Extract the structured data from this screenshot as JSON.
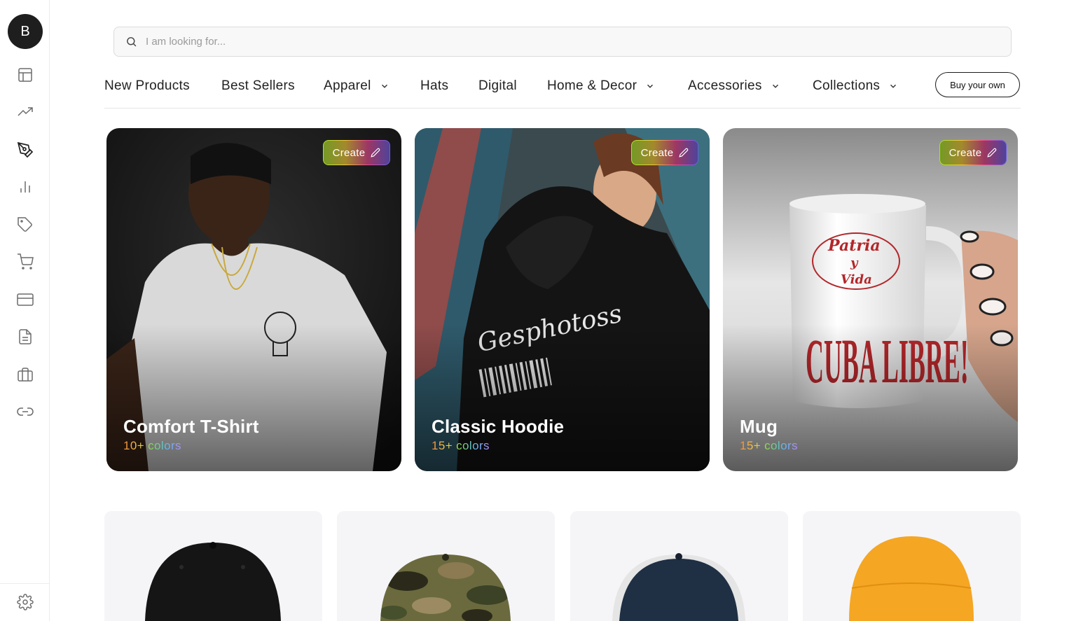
{
  "sidebar": {
    "avatar_initial": "B",
    "icons": [
      "layout-icon",
      "trending-up-icon",
      "pen-tool-icon",
      "bar-chart-icon",
      "tag-icon",
      "cart-icon",
      "credit-card-icon",
      "document-icon",
      "briefcase-icon",
      "link-icon",
      "settings-icon"
    ]
  },
  "search": {
    "placeholder": "I am looking for..."
  },
  "nav": {
    "items": [
      {
        "label": "New Products"
      },
      {
        "label": "Best Sellers"
      },
      {
        "label": "Apparel"
      },
      {
        "label": "Hats"
      },
      {
        "label": "Digital"
      },
      {
        "label": "Home & Decor"
      },
      {
        "label": "Accessories"
      },
      {
        "label": "Collections"
      }
    ],
    "buy_label": "Buy your own"
  },
  "featured": [
    {
      "title": "Comfort T-Shirt",
      "subtitle": "10+ colors",
      "create_label": "Create"
    },
    {
      "title": "Classic Hoodie",
      "subtitle": "15+ colors",
      "create_label": "Create"
    },
    {
      "title": "Mug",
      "subtitle": "15+ colors",
      "create_label": "Create"
    }
  ],
  "products": [
    {
      "name": "black-cap",
      "color": "#151515"
    },
    {
      "name": "camo-cap",
      "color": "#5b5a36"
    },
    {
      "name": "trucker-cap",
      "color": "#1f2f44"
    },
    {
      "name": "beanie",
      "color": "#f5a623"
    }
  ],
  "colors": {
    "accent_dark": "#1b1b1b",
    "tile_bg": "#f5f5f8",
    "subtitle_gradient": [
      "#f08a3c",
      "#f2c94c",
      "#7ed957",
      "#5ab8f0",
      "#b48cf2"
    ]
  }
}
